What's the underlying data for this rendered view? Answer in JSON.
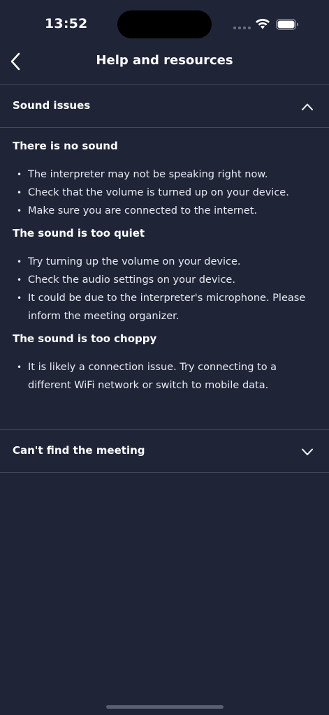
{
  "status_bar": {
    "time": "13:52"
  },
  "nav": {
    "title": "Help and resources",
    "back_icon": "chevron-left-icon"
  },
  "sections": [
    {
      "title": "Sound issues",
      "expanded": true,
      "chevron_icon": "chevron-up-icon",
      "groups": [
        {
          "heading": "There is no sound",
          "items": [
            "The interpreter may not be speaking right now.",
            "Check that the volume is turned up on your device.",
            "Make sure you are connected to the internet."
          ]
        },
        {
          "heading": "The sound is too quiet",
          "items": [
            "Try turning up the volume on your device.",
            "Check the audio settings on your device.",
            "It could be due to the interpreter's microphone. Please inform the meeting organizer."
          ]
        },
        {
          "heading": "The sound is too choppy",
          "items": [
            "It is likely a connection issue. Try connecting to a different WiFi network or switch to mobile data."
          ]
        }
      ]
    },
    {
      "title": "Can't find the meeting",
      "expanded": false,
      "chevron_icon": "chevron-down-icon"
    }
  ],
  "colors": {
    "background": "#1f2437",
    "divider": "#454a5c",
    "text": "#ffffff"
  }
}
